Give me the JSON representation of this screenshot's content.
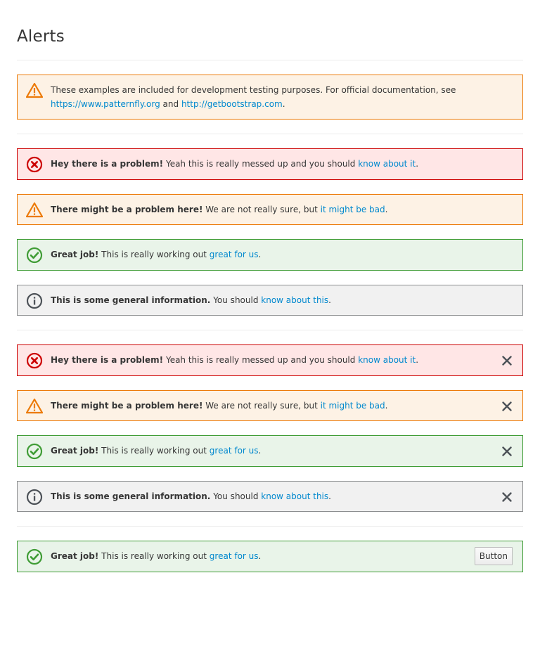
{
  "page_title": "Alerts",
  "intro": {
    "text1": "These examples are included for development testing purposes. For official documentation, see",
    "link1": "https://www.patternfly.org",
    "and": "and",
    "link2": "http://getbootstrap.com",
    "end": "."
  },
  "alerts": {
    "danger": {
      "strong": "Hey there is a problem!",
      "text": "Yeah this is really messed up and you should",
      "link": "know about it",
      "end": "."
    },
    "warning": {
      "strong": "There might be a problem here!",
      "text": "We are not really sure, but",
      "link": "it might be bad",
      "end": "."
    },
    "success": {
      "strong": "Great job!",
      "text": "This is really working out",
      "link": "great for us",
      "end": "."
    },
    "info": {
      "strong": "This is some general information.",
      "text": "You should",
      "link": "know about this",
      "end": "."
    }
  },
  "action_button_label": "Button",
  "colors": {
    "danger": "#cc0000",
    "warning": "#ec7a08",
    "success": "#3f9c35",
    "info": "#4d5258",
    "link": "#0088ce"
  }
}
